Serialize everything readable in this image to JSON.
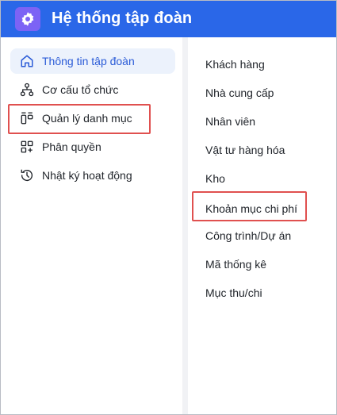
{
  "header": {
    "title": "Hệ thống tập đoàn",
    "icon": "gear-icon",
    "color": "#2a67e8"
  },
  "sidebar": {
    "items": [
      {
        "label": "Thông tin tập đoàn",
        "icon": "home-icon",
        "active": true
      },
      {
        "label": "Cơ cấu tổ chức",
        "icon": "org-chart-icon"
      },
      {
        "label": "Quản lý danh mục",
        "icon": "catalog-icon",
        "highlighted": true
      },
      {
        "label": "Phân quyền",
        "icon": "permissions-icon"
      },
      {
        "label": "Nhật ký hoạt động",
        "icon": "history-icon"
      }
    ]
  },
  "catalog": {
    "items": [
      {
        "label": "Khách hàng"
      },
      {
        "label": "Nhà cung cấp"
      },
      {
        "label": "Nhân viên"
      },
      {
        "label": "Vật tư hàng hóa"
      },
      {
        "label": "Kho"
      },
      {
        "label": "Khoản mục chi phí",
        "highlighted": true
      },
      {
        "label": "Công trình/Dự án"
      },
      {
        "label": "Mã thống kê"
      },
      {
        "label": "Mục thu/chi"
      }
    ]
  },
  "colors": {
    "accent": "#2a67e8",
    "active_bg": "#ecf2fc",
    "highlight": "#e0504f"
  }
}
